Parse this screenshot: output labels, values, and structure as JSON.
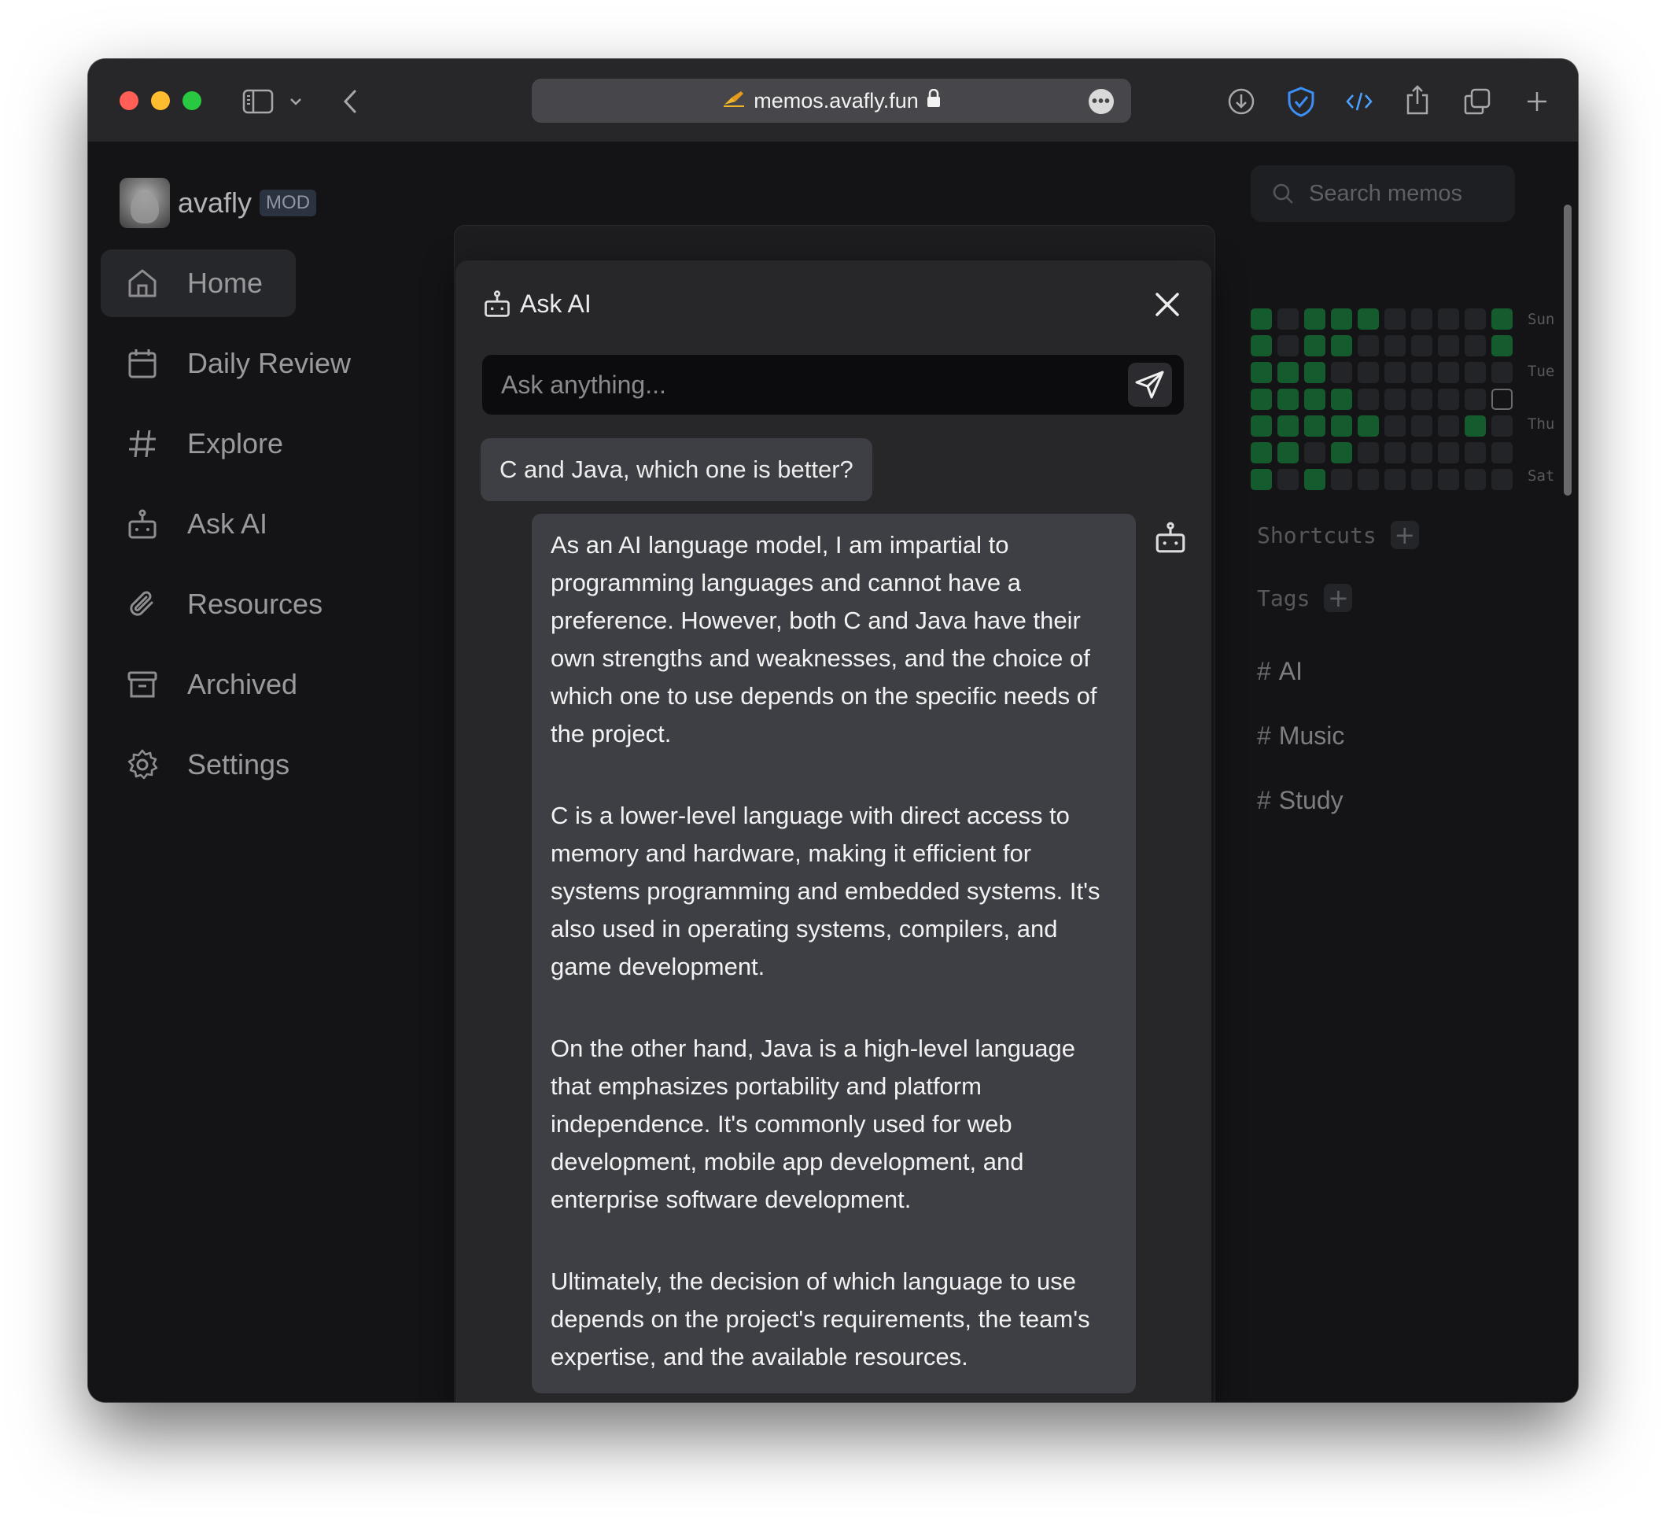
{
  "browser": {
    "url": "memos.avafly.fun",
    "colors": {
      "red": "#ff5f57",
      "yellow": "#febc2e",
      "green": "#28c840",
      "shield": "#3b8ff6",
      "devtools": "#4aa3ff"
    }
  },
  "sidebar": {
    "username": "avafly",
    "role_badge": "MOD",
    "items": [
      {
        "label": "Home",
        "icon": "home-icon",
        "active": true
      },
      {
        "label": "Daily Review",
        "icon": "calendar-icon"
      },
      {
        "label": "Explore",
        "icon": "hash-icon"
      },
      {
        "label": "Ask AI",
        "icon": "bot-icon"
      },
      {
        "label": "Resources",
        "icon": "paperclip-icon"
      },
      {
        "label": "Archived",
        "icon": "archive-icon"
      },
      {
        "label": "Settings",
        "icon": "gear-icon"
      }
    ]
  },
  "dialog": {
    "title": "Ask AI",
    "input_placeholder": "Ask anything...",
    "question": "C and Java, which one is better?",
    "answer": [
      "As an AI language model, I am impartial to programming languages and cannot have a preference. However, both C and Java have their own strengths and weaknesses, and the choice of which one to use depends on the specific needs of the project.",
      "C is a lower-level language with direct access to memory and hardware, making it efficient for systems programming and embedded systems. It's also used in operating systems, compilers, and game development.",
      "On the other hand, Java is a high-level language that emphasizes portability and platform independence. It's commonly used for web development, mobile app development, and enterprise software development.",
      "Ultimately, the decision of which language to use depends on the project's requirements, the team's expertise, and the available resources."
    ]
  },
  "right_panel": {
    "search_placeholder": "Search memos",
    "heatmap_day_labels": [
      "Sun",
      "Tue",
      "Thu",
      "Sat"
    ],
    "heatmap_colors": {
      "empty": "#232427",
      "active": "#145c2e",
      "today_outline": "#6a6b6e"
    },
    "shortcuts_label": "Shortcuts",
    "tags_label": "Tags",
    "tags": [
      "AI",
      "Music",
      "Study"
    ]
  }
}
